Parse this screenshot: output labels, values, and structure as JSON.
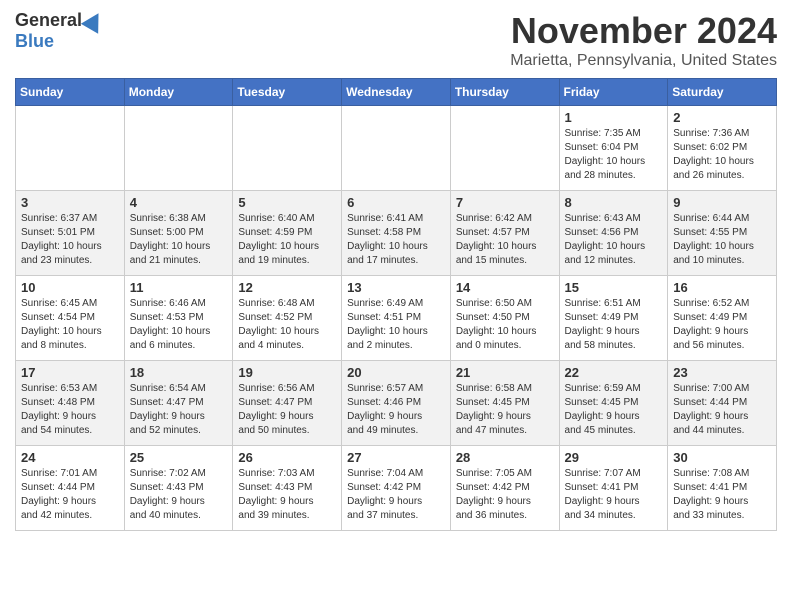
{
  "header": {
    "logo_general": "General",
    "logo_blue": "Blue",
    "month": "November 2024",
    "location": "Marietta, Pennsylvania, United States"
  },
  "weekdays": [
    "Sunday",
    "Monday",
    "Tuesday",
    "Wednesday",
    "Thursday",
    "Friday",
    "Saturday"
  ],
  "weeks": [
    [
      {
        "day": "",
        "info": ""
      },
      {
        "day": "",
        "info": ""
      },
      {
        "day": "",
        "info": ""
      },
      {
        "day": "",
        "info": ""
      },
      {
        "day": "",
        "info": ""
      },
      {
        "day": "1",
        "info": "Sunrise: 7:35 AM\nSunset: 6:04 PM\nDaylight: 10 hours\nand 28 minutes."
      },
      {
        "day": "2",
        "info": "Sunrise: 7:36 AM\nSunset: 6:02 PM\nDaylight: 10 hours\nand 26 minutes."
      }
    ],
    [
      {
        "day": "3",
        "info": "Sunrise: 6:37 AM\nSunset: 5:01 PM\nDaylight: 10 hours\nand 23 minutes."
      },
      {
        "day": "4",
        "info": "Sunrise: 6:38 AM\nSunset: 5:00 PM\nDaylight: 10 hours\nand 21 minutes."
      },
      {
        "day": "5",
        "info": "Sunrise: 6:40 AM\nSunset: 4:59 PM\nDaylight: 10 hours\nand 19 minutes."
      },
      {
        "day": "6",
        "info": "Sunrise: 6:41 AM\nSunset: 4:58 PM\nDaylight: 10 hours\nand 17 minutes."
      },
      {
        "day": "7",
        "info": "Sunrise: 6:42 AM\nSunset: 4:57 PM\nDaylight: 10 hours\nand 15 minutes."
      },
      {
        "day": "8",
        "info": "Sunrise: 6:43 AM\nSunset: 4:56 PM\nDaylight: 10 hours\nand 12 minutes."
      },
      {
        "day": "9",
        "info": "Sunrise: 6:44 AM\nSunset: 4:55 PM\nDaylight: 10 hours\nand 10 minutes."
      }
    ],
    [
      {
        "day": "10",
        "info": "Sunrise: 6:45 AM\nSunset: 4:54 PM\nDaylight: 10 hours\nand 8 minutes."
      },
      {
        "day": "11",
        "info": "Sunrise: 6:46 AM\nSunset: 4:53 PM\nDaylight: 10 hours\nand 6 minutes."
      },
      {
        "day": "12",
        "info": "Sunrise: 6:48 AM\nSunset: 4:52 PM\nDaylight: 10 hours\nand 4 minutes."
      },
      {
        "day": "13",
        "info": "Sunrise: 6:49 AM\nSunset: 4:51 PM\nDaylight: 10 hours\nand 2 minutes."
      },
      {
        "day": "14",
        "info": "Sunrise: 6:50 AM\nSunset: 4:50 PM\nDaylight: 10 hours\nand 0 minutes."
      },
      {
        "day": "15",
        "info": "Sunrise: 6:51 AM\nSunset: 4:49 PM\nDaylight: 9 hours\nand 58 minutes."
      },
      {
        "day": "16",
        "info": "Sunrise: 6:52 AM\nSunset: 4:49 PM\nDaylight: 9 hours\nand 56 minutes."
      }
    ],
    [
      {
        "day": "17",
        "info": "Sunrise: 6:53 AM\nSunset: 4:48 PM\nDaylight: 9 hours\nand 54 minutes."
      },
      {
        "day": "18",
        "info": "Sunrise: 6:54 AM\nSunset: 4:47 PM\nDaylight: 9 hours\nand 52 minutes."
      },
      {
        "day": "19",
        "info": "Sunrise: 6:56 AM\nSunset: 4:47 PM\nDaylight: 9 hours\nand 50 minutes."
      },
      {
        "day": "20",
        "info": "Sunrise: 6:57 AM\nSunset: 4:46 PM\nDaylight: 9 hours\nand 49 minutes."
      },
      {
        "day": "21",
        "info": "Sunrise: 6:58 AM\nSunset: 4:45 PM\nDaylight: 9 hours\nand 47 minutes."
      },
      {
        "day": "22",
        "info": "Sunrise: 6:59 AM\nSunset: 4:45 PM\nDaylight: 9 hours\nand 45 minutes."
      },
      {
        "day": "23",
        "info": "Sunrise: 7:00 AM\nSunset: 4:44 PM\nDaylight: 9 hours\nand 44 minutes."
      }
    ],
    [
      {
        "day": "24",
        "info": "Sunrise: 7:01 AM\nSunset: 4:44 PM\nDaylight: 9 hours\nand 42 minutes."
      },
      {
        "day": "25",
        "info": "Sunrise: 7:02 AM\nSunset: 4:43 PM\nDaylight: 9 hours\nand 40 minutes."
      },
      {
        "day": "26",
        "info": "Sunrise: 7:03 AM\nSunset: 4:43 PM\nDaylight: 9 hours\nand 39 minutes."
      },
      {
        "day": "27",
        "info": "Sunrise: 7:04 AM\nSunset: 4:42 PM\nDaylight: 9 hours\nand 37 minutes."
      },
      {
        "day": "28",
        "info": "Sunrise: 7:05 AM\nSunset: 4:42 PM\nDaylight: 9 hours\nand 36 minutes."
      },
      {
        "day": "29",
        "info": "Sunrise: 7:07 AM\nSunset: 4:41 PM\nDaylight: 9 hours\nand 34 minutes."
      },
      {
        "day": "30",
        "info": "Sunrise: 7:08 AM\nSunset: 4:41 PM\nDaylight: 9 hours\nand 33 minutes."
      }
    ]
  ]
}
